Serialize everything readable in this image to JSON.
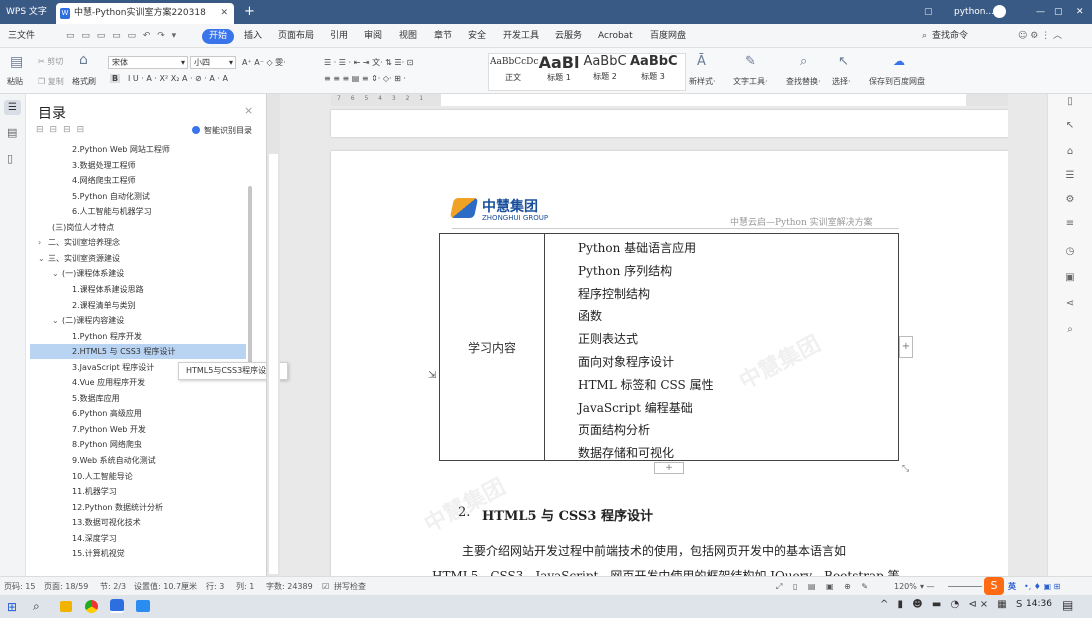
{
  "titlebar": {
    "app": "WPS 文字",
    "doc_tab": "中慧-Python实训室方案220318",
    "tab2": "python...",
    "new_tab": "+"
  },
  "menu": {
    "file": "三文件",
    "items": [
      "开始",
      "插入",
      "页面布局",
      "引用",
      "审阅",
      "视图",
      "章节",
      "安全",
      "开发工具",
      "云服务",
      "Acrobat",
      "百度网盘"
    ],
    "search": "查找命令"
  },
  "ribbon": {
    "paste": "粘贴",
    "cut": "剪切",
    "copy": "复制",
    "format_painter": "格式刷",
    "font": "宋体",
    "size": "小四",
    "styles": [
      {
        "preview": "AaBbCcDc",
        "label": "正文"
      },
      {
        "preview": "AaBl",
        "label": "标题 1"
      },
      {
        "preview": "AaBbC",
        "label": "标题 2"
      },
      {
        "preview": "AaBbC",
        "label": "标题 3"
      }
    ],
    "new_style": "新样式",
    "text_tools": "文字工具",
    "find_replace": "查找替换",
    "select": "选择",
    "save_baidu": "保存到百度网盘"
  },
  "toc": {
    "title": "目录",
    "smart": "智能识别目录",
    "items": [
      {
        "text": "2.Python Web 网站工程师",
        "level": 3
      },
      {
        "text": "3.数据处理工程师",
        "level": 3
      },
      {
        "text": "4.网络爬虫工程师",
        "level": 3
      },
      {
        "text": "5.Python 自动化测试",
        "level": 3
      },
      {
        "text": "6.人工智能与机器学习",
        "level": 3
      },
      {
        "text": "(三)岗位人才特点",
        "level": 2
      },
      {
        "text": "二、实训室培养理念",
        "level": 1,
        "arrow": ">"
      },
      {
        "text": "三、实训室资源建设",
        "level": 1,
        "arrow": "v"
      },
      {
        "text": "(一)课程体系建设",
        "level": 2,
        "arrow": "v"
      },
      {
        "text": "1.课程体系建设思路",
        "level": 3
      },
      {
        "text": "2.课程清单与类别",
        "level": 3
      },
      {
        "text": "(二)课程内容建设",
        "level": 2,
        "arrow": "v"
      },
      {
        "text": "1.Python 程序开发",
        "level": 3
      },
      {
        "text": "2.HTML5 与 CSS3 程序设计",
        "level": 3,
        "selected": true
      },
      {
        "text": "3.JavaScript 程序设计",
        "level": 3
      },
      {
        "text": "4.Vue 应用程序开发",
        "level": 3
      },
      {
        "text": "5.数据库应用",
        "level": 3
      },
      {
        "text": "6.Python 高级应用",
        "level": 3
      },
      {
        "text": "7.Python Web 开发",
        "level": 3
      },
      {
        "text": "8.Python  网络爬虫",
        "level": 3
      },
      {
        "text": "9.Web 系统自动化测试",
        "level": 3
      },
      {
        "text": "10.人工智能导论",
        "level": 3
      },
      {
        "text": "11.机器学习",
        "level": 3
      },
      {
        "text": "12.Python 数据统计分析",
        "level": 3
      },
      {
        "text": "13.数据可视化技术",
        "level": 3
      },
      {
        "text": "14.深度学习",
        "level": 3
      },
      {
        "text": "15.计算机视觉",
        "level": 3
      }
    ],
    "tooltip": "HTML5与CSS3程序设计"
  },
  "doc": {
    "logo_cn": "中慧集团",
    "logo_en": "ZHONGHUI GROUP",
    "header_right": "中慧云启—Python 实训室解决方案",
    "table_label": "学习内容",
    "table_items": [
      "Python 基础语言应用",
      "Python 序列结构",
      "程序控制结构",
      "函数",
      "正则表达式",
      "面向对象程序设计",
      "HTML 标签和 CSS 属性",
      "JavaScript 编程基础",
      "页面结构分析",
      "数据存储和可视化"
    ],
    "heading_num": "2.",
    "heading": "HTML5 与 CSS3 程序设计",
    "para1": "主要介绍网站开发过程中前端技术的使用，包括网页开发中的基本语言如",
    "para2": "HTML5、CSS3、JavaScript，网页开发中使用的框架结构如 JQuery、Bootstrap 等",
    "watermark": "中慧集团"
  },
  "status": {
    "page": "页码: 15",
    "pages": "页面: 18/59",
    "section": "节: 2/3",
    "setting": "设置值: 10.7厘米",
    "row": "行: 3",
    "col": "列: 1",
    "words": "字数: 24389",
    "spell": "拼写检查",
    "zoom": "120%"
  },
  "taskbar": {
    "time": "14:36",
    "ime": "英"
  }
}
